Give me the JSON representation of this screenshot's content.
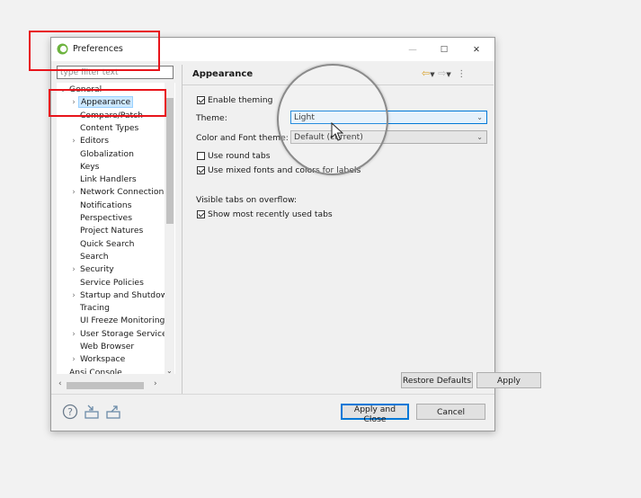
{
  "window": {
    "title": "Preferences"
  },
  "controls": {
    "minimize": "—",
    "maximize": "☐",
    "close": "✕"
  },
  "sidebar": {
    "filter_placeholder": "type filter text",
    "items": [
      {
        "label": "General",
        "indent": 0,
        "chevron": "⌄"
      },
      {
        "label": "Appearance",
        "indent": 1,
        "chevron": "›",
        "selected": true
      },
      {
        "label": "Compare/Patch",
        "indent": 1,
        "chevron": ""
      },
      {
        "label": "Content Types",
        "indent": 1,
        "chevron": ""
      },
      {
        "label": "Editors",
        "indent": 1,
        "chevron": "›"
      },
      {
        "label": "Globalization",
        "indent": 1,
        "chevron": ""
      },
      {
        "label": "Keys",
        "indent": 1,
        "chevron": ""
      },
      {
        "label": "Link Handlers",
        "indent": 1,
        "chevron": ""
      },
      {
        "label": "Network Connection",
        "indent": 1,
        "chevron": "›"
      },
      {
        "label": "Notifications",
        "indent": 1,
        "chevron": ""
      },
      {
        "label": "Perspectives",
        "indent": 1,
        "chevron": ""
      },
      {
        "label": "Project Natures",
        "indent": 1,
        "chevron": ""
      },
      {
        "label": "Quick Search",
        "indent": 1,
        "chevron": ""
      },
      {
        "label": "Search",
        "indent": 1,
        "chevron": ""
      },
      {
        "label": "Security",
        "indent": 1,
        "chevron": "›"
      },
      {
        "label": "Service Policies",
        "indent": 1,
        "chevron": ""
      },
      {
        "label": "Startup and Shutdow",
        "indent": 1,
        "chevron": "›"
      },
      {
        "label": "Tracing",
        "indent": 1,
        "chevron": ""
      },
      {
        "label": "UI Freeze Monitoring",
        "indent": 1,
        "chevron": ""
      },
      {
        "label": "User Storage Service",
        "indent": 1,
        "chevron": "›"
      },
      {
        "label": "Web Browser",
        "indent": 1,
        "chevron": ""
      },
      {
        "label": "Workspace",
        "indent": 1,
        "chevron": "›"
      },
      {
        "label": "Ansi Console",
        "indent": 0,
        "chevron": ""
      }
    ]
  },
  "page": {
    "title": "Appearance",
    "enable_theming": {
      "label": "Enable theming",
      "checked": true
    },
    "theme": {
      "label": "Theme:",
      "value": "Light"
    },
    "color_font_theme": {
      "label": "Color and Font theme:",
      "value": "Default (current)"
    },
    "round_tabs": {
      "label": "Use round tabs",
      "checked": false
    },
    "mixed_fonts": {
      "label": "Use mixed fonts and colors for labels",
      "checked": true
    },
    "overflow_heading": "Visible tabs on overflow:",
    "recent_tabs": {
      "label": "Show most recently used tabs",
      "checked": true
    },
    "restore_defaults": "Restore Defaults",
    "apply": "Apply"
  },
  "footer": {
    "apply_close": "Apply and Close",
    "cancel": "Cancel"
  },
  "colors": {
    "annotation": "#e8141b",
    "accent": "#0078d7",
    "selection": "#cce8ff"
  }
}
